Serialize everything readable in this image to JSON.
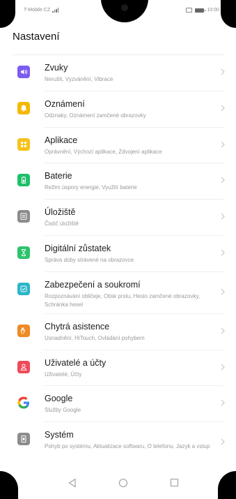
{
  "status": {
    "carrier": "T-Mobile CZ",
    "time": "10:00"
  },
  "colors": {
    "sound": "#7b5cf0",
    "notifications": "#f5b800",
    "apps": "#f7c21a",
    "battery": "#1fbf6a",
    "storage": "#8c8c8c",
    "digital": "#2ec36b",
    "security": "#2bb6c9",
    "assist": "#f08a25",
    "users": "#ee4b5b",
    "google": "#ffffff",
    "system": "#8c8c8c"
  },
  "header": {
    "title": "Nastavení"
  },
  "items": [
    {
      "label": "Zvuky",
      "sub": "Nerušit, Vyzvánění, Vibrace",
      "icon": "speaker-icon"
    },
    {
      "label": "Oznámení",
      "sub": "Odznaky, Oznámení zamčené obrazovky",
      "icon": "bell-icon"
    },
    {
      "label": "Aplikace",
      "sub": "Oprávnění, Výchozí aplikace, Zdvojení aplikace",
      "icon": "apps-grid-icon"
    },
    {
      "label": "Baterie",
      "sub": "Režim úspory energie, Využití baterie",
      "icon": "battery-icon"
    },
    {
      "label": "Úložiště",
      "sub": "Čistič úložiště",
      "icon": "storage-icon"
    },
    {
      "label": "Digitální zůstatek",
      "sub": "Správa doby strávené na obrazovce",
      "icon": "hourglass-icon"
    },
    {
      "label": "Zabezpečení a soukromí",
      "sub": "Rozpoznávání obličeje, Otisk prstu, Heslo zamčené obrazovky, Schránka hesel",
      "icon": "shield-icon"
    },
    {
      "label": "Chytrá asistence",
      "sub": "Usnadnění, HiTouch, Ovládání pohybem",
      "icon": "hand-icon"
    },
    {
      "label": "Uživatelé a účty",
      "sub": "Uživatelé, Účty",
      "icon": "user-icon"
    },
    {
      "label": "Google",
      "sub": "Služby Google",
      "icon": "google-icon"
    },
    {
      "label": "Systém",
      "sub": "Pohyb po systému, Aktualizace softwaru, O telefonu, Jazyk a vstup",
      "icon": "phone-info-icon"
    }
  ]
}
